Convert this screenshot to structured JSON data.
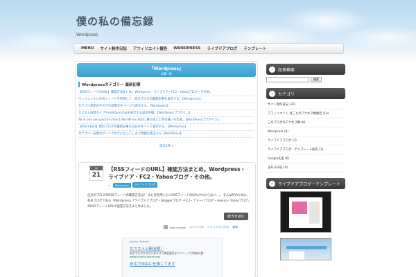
{
  "site": {
    "title": "僕の私の備忘録",
    "description": "Wordpress"
  },
  "nav": [
    "MENU",
    "サイト制作日記",
    "アフィリエイト報告",
    "WORDPRESS",
    "ライブドアブログ",
    "テンプレート"
  ],
  "category_banner": {
    "title": "『Wordpress』",
    "subtitle": "記事一覧"
  },
  "recent": {
    "heading": "Wordpressカテゴリー 最新記事",
    "items": [
      "【RSSフィードのURL】確認方法まとめ。Wordpress・ライブドア・FC2・Yahooブログ・その他。",
      "ウィジェットにRSSフィードを利用して、他のブログの最新記事を表示する。【Wordpress】",
      "カテゴリ説明文やタグの説明文をページで表示する。【Wordpress】",
      "カスタム投稿タイプやAddQuicktagを表示する設定手順。【Wordpressプラグイン】",
      "All in one seo packからYoast WordPress SEOに乗り換えた時の違いを比較。【WordPressプラグイン】",
      "【RSS FEED】他のブログの最新記事を自分のサイトで表示する。【Wordpress】",
      "カテゴリー説明文がリンク付きになってしまう問題を修正する【WordPress】"
    ],
    "more": "次の5件 »"
  },
  "post": {
    "month": "Jul",
    "day": "21",
    "title": "【RSSフィードのURL】確認方法まとめ。Wordpress・ライブドア・FC2・Yahooブログ・その他。",
    "tags": [
      "Wordpress",
      "ライブドアブログ"
    ],
    "body": "自分のブログのRSSフィードの確認方法は？ また社利用したいRSSフィードのURLがわからない…。 そんな時のために、有名ブログである「Wordpress」「ライブドアブログ・Bloggerブログ・FC2・アメーバブログ・seesaa・Yahooブログ」のRSSフィードURLや設定方法をまとめました。",
    "read_more": "続きを読む",
    "meta": {
      "author": "wolf_snoopy",
      "comments": "コメント(0)",
      "trackbacks": "トラックバック(0)",
      "edit": "編集"
    },
    "ad": {
      "by": "Ads by Yoshiori",
      "title": "おススメ公開治療！",
      "desc": "安全でもわかる方にあススメ美容整形なクリニックが新規公開！",
      "url": "www.osharu-stylen.org",
      "title2": "自宅で自由に仕事してます"
    }
  },
  "sidebar": {
    "search": {
      "heading": "記事検索",
      "placeholder": "",
      "button": "検索"
    },
    "categories": {
      "heading": "カテゴリ",
      "items": [
        "サイト制作日記 (31)",
        "アフィリエイト 月ごとのアクセス数報告 (14)",
        "このブログのアクセス数 (8)",
        "Wordpress (8)",
        "ライブドアブログ (3)",
        "ライブドアブログ・テンプレート配布 (3)",
        "Google先生 (6)",
        "宙なる日記 (4)"
      ]
    },
    "templates": {
      "heading": "ライブドアブログ・テンプレート"
    }
  }
}
